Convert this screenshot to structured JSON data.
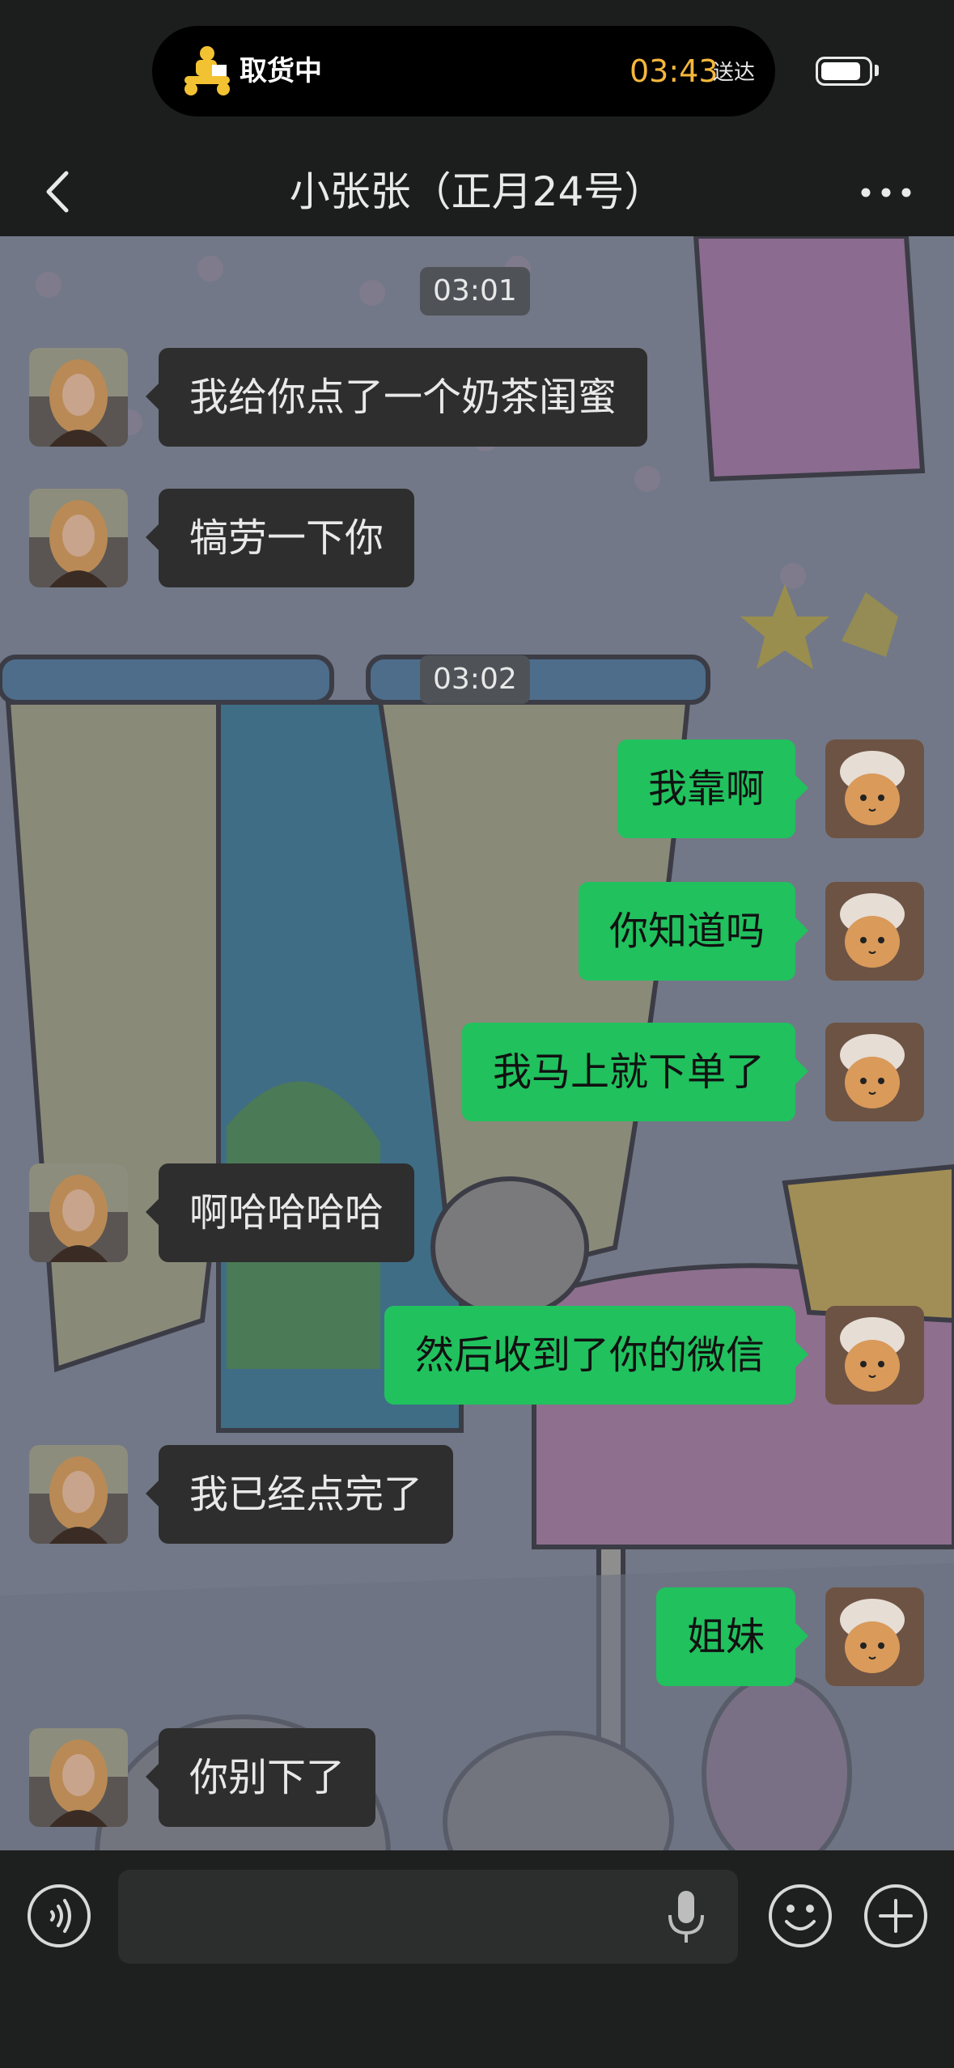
{
  "status": {
    "delivery_status": "取货中",
    "delivery_time": "03:43",
    "delivery_suffix": "送达",
    "battery_level": 0.85
  },
  "header": {
    "title": "小张张（正月24号）",
    "back_icon": "chevron-left-icon",
    "more_icon": "more-dots-icon"
  },
  "messages": [
    {
      "type": "time",
      "text": "03:01"
    },
    {
      "type": "msg",
      "side": "left",
      "text": "我给你点了一个奶茶闺蜜"
    },
    {
      "type": "msg",
      "side": "left",
      "text": "犒劳一下你"
    },
    {
      "type": "time",
      "text": "03:02"
    },
    {
      "type": "msg",
      "side": "right",
      "text": "我靠啊"
    },
    {
      "type": "msg",
      "side": "right",
      "text": "你知道吗"
    },
    {
      "type": "msg",
      "side": "right",
      "text": "我马上就下单了"
    },
    {
      "type": "msg",
      "side": "left",
      "text": "啊哈哈哈哈"
    },
    {
      "type": "msg",
      "side": "right",
      "text": "然后收到了你的微信"
    },
    {
      "type": "msg",
      "side": "left",
      "text": "我已经点完了"
    },
    {
      "type": "msg",
      "side": "right",
      "text": "姐妹"
    },
    {
      "type": "msg",
      "side": "left",
      "text": "你别下了"
    }
  ],
  "input_bar": {
    "voice_icon": "voice-wave-icon",
    "input_value": "",
    "mic_icon": "microphone-icon",
    "emoji_icon": "smiley-icon",
    "plus_icon": "plus-circle-icon"
  },
  "colors": {
    "outgoing_bubble": "#21c15e",
    "incoming_bubble": "#2e2e2e",
    "accent_time": "#f5b73b"
  }
}
